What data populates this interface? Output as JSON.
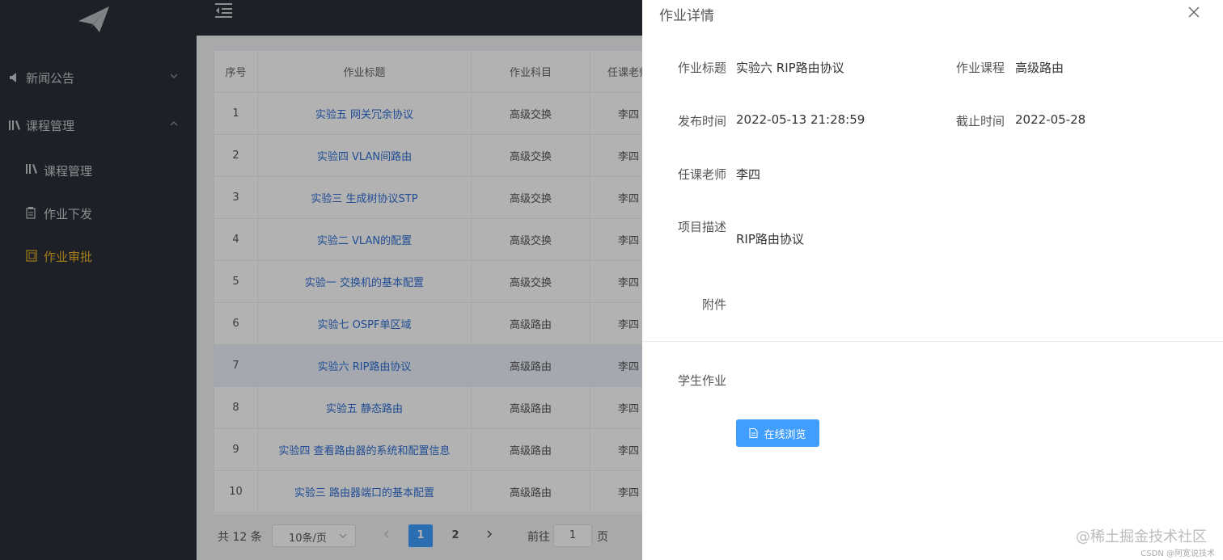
{
  "sidebar": {
    "menu": [
      {
        "label": "新闻公告",
        "icon": "speaker-icon"
      },
      {
        "label": "课程管理",
        "icon": "books-icon"
      }
    ],
    "sub_items": [
      {
        "label": "课程管理",
        "icon": "books-icon"
      },
      {
        "label": "作业下发",
        "icon": "clipboard-icon"
      },
      {
        "label": "作业审批",
        "icon": "approve-icon"
      }
    ],
    "active_color": "#e6b422"
  },
  "table": {
    "headers": [
      "序号",
      "作业标题",
      "作业科目",
      "任课老师"
    ],
    "rows": [
      {
        "no": "1",
        "title": "实验五 网关冗余协议",
        "subject": "高级交换",
        "teacher": "李四"
      },
      {
        "no": "2",
        "title": "实验四 VLAN间路由",
        "subject": "高级交换",
        "teacher": "李四"
      },
      {
        "no": "3",
        "title": "实验三 生成树协议STP",
        "subject": "高级交换",
        "teacher": "李四"
      },
      {
        "no": "4",
        "title": "实验二 VLAN的配置",
        "subject": "高级交换",
        "teacher": "李四"
      },
      {
        "no": "5",
        "title": "实验一 交换机的基本配置",
        "subject": "高级交换",
        "teacher": "李四"
      },
      {
        "no": "6",
        "title": "实验七 OSPF单区域",
        "subject": "高级路由",
        "teacher": "李四"
      },
      {
        "no": "7",
        "title": "实验六 RIP路由协议",
        "subject": "高级路由",
        "teacher": "李四"
      },
      {
        "no": "8",
        "title": "实验五 静态路由",
        "subject": "高级路由",
        "teacher": "李四"
      },
      {
        "no": "9",
        "title": "实验四 查看路由器的系统和配置信息",
        "subject": "高级路由",
        "teacher": "李四"
      },
      {
        "no": "10",
        "title": "实验三 路由器端口的基本配置",
        "subject": "高级路由",
        "teacher": "李四"
      }
    ]
  },
  "pagination": {
    "total": "共 12 条",
    "page_size": "10条/页",
    "pages": [
      "1",
      "2"
    ],
    "goto_label": "前往",
    "goto_value": "1",
    "page_suffix": "页"
  },
  "drawer": {
    "title": "作业详情",
    "fields": {
      "title_label": "作业标题",
      "title_value": "实验六 RIP路由协议",
      "course_label": "作业课程",
      "course_value": "高级路由",
      "publish_label": "发布时间",
      "publish_value": "2022-05-13 21:28:59",
      "deadline_label": "截止时间",
      "deadline_value": "2022-05-28",
      "teacher_label": "任课老师",
      "teacher_value": "李四",
      "desc_label": "项目描述",
      "desc_value": "RIP路由协议",
      "attach_label": "附件",
      "student_label": "学生作业"
    },
    "view_button": "在线浏览"
  },
  "watermark": {
    "main": "@稀土掘金技术社区",
    "sub": "CSDN @阿宽说技术"
  }
}
